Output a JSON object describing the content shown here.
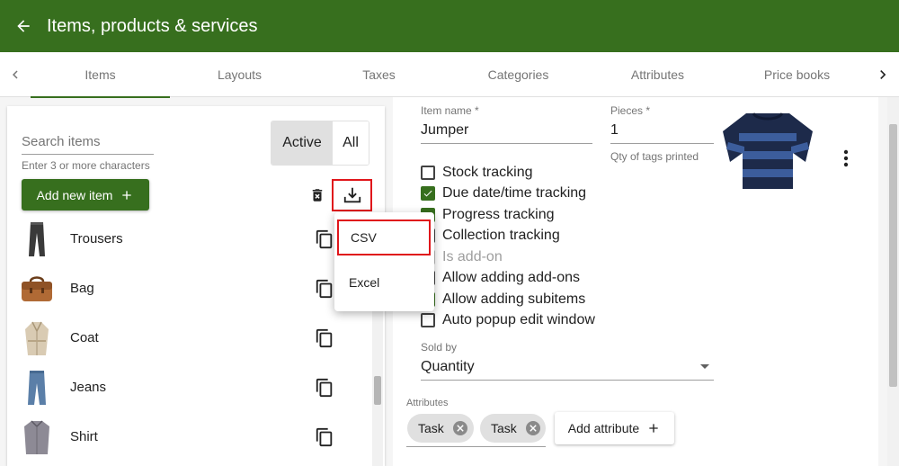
{
  "appbar": {
    "title": "Items, products & services"
  },
  "tabs": [
    {
      "label": "Items"
    },
    {
      "label": "Layouts"
    },
    {
      "label": "Taxes"
    },
    {
      "label": "Categories"
    },
    {
      "label": "Attributes"
    },
    {
      "label": "Price books"
    }
  ],
  "left": {
    "search_placeholder": "Search items",
    "search_value": "",
    "search_hint": "Enter 3 or more characters",
    "toggle_active": "Active",
    "toggle_all": "All",
    "add_item_label": "Add new item",
    "items": [
      {
        "name": "Trousers",
        "icon": "trousers-icon"
      },
      {
        "name": "Bag",
        "icon": "bag-icon"
      },
      {
        "name": "Coat",
        "icon": "coat-icon"
      },
      {
        "name": "Jeans",
        "icon": "jeans-icon"
      },
      {
        "name": "Shirt",
        "icon": "shirt-icon"
      }
    ]
  },
  "export_menu": {
    "csv": "CSV",
    "excel": "Excel"
  },
  "form": {
    "item_name_label": "Item name *",
    "item_name_value": "Jumper",
    "pieces_label": "Pieces *",
    "pieces_value": "1",
    "pieces_helper": "Qty of tags printed",
    "checkboxes": [
      {
        "label": "Stock tracking",
        "checked": false,
        "disabled": false
      },
      {
        "label": "Due date/time tracking",
        "checked": true,
        "disabled": false
      },
      {
        "label": "Progress tracking",
        "checked": true,
        "disabled": false
      },
      {
        "label": "Collection tracking",
        "checked": false,
        "disabled": false
      },
      {
        "label": "Is add-on",
        "checked": false,
        "disabled": true
      },
      {
        "label": "Allow adding add-ons",
        "checked": false,
        "disabled": false
      },
      {
        "label": "Allow adding subitems",
        "checked": true,
        "disabled": false
      },
      {
        "label": "Auto popup edit window",
        "checked": false,
        "disabled": false
      }
    ],
    "sold_by_label": "Sold by",
    "sold_by_value": "Quantity",
    "attributes_label": "Attributes",
    "attribute_chips": [
      "Task",
      "Task"
    ],
    "add_attribute_label": "Add attribute"
  },
  "colors": {
    "primary": "#376f1e",
    "highlight": "#e0161b"
  }
}
